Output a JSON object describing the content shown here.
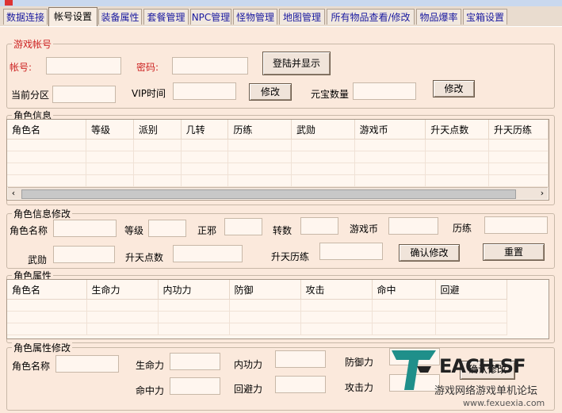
{
  "tabs": [
    "数据连接",
    "帐号设置",
    "装备属性",
    "套餐管理",
    "NPC管理",
    "怪物管理",
    "地图管理",
    "所有物品查看/修改",
    "物品爆率",
    "宝箱设置"
  ],
  "account": {
    "title": "游戏帐号",
    "account_label": "帐号:",
    "password_label": "密码:",
    "login_button": "登陆并显示",
    "zone_label": "当前分区",
    "vip_label": "VIP时间",
    "vip_modify": "修改",
    "yuanbao_label": "元宝数量",
    "yuanbao_modify": "修改"
  },
  "role_info": {
    "title": "角色信息",
    "columns": [
      "角色名",
      "等级",
      "派别",
      "几转",
      "历练",
      "武勋",
      "游戏币",
      "升天点数",
      "升天历练"
    ]
  },
  "role_edit": {
    "title": "角色信息修改",
    "name": "角色名称",
    "level": "等级",
    "alignment": "正邪",
    "rebirth": "转数",
    "coins": "游戏币",
    "experience": "历练",
    "honor": "武勋",
    "ascend_points": "升天点数",
    "ascend_exp": "升天历练",
    "confirm": "确认修改",
    "reset": "重置"
  },
  "role_attr": {
    "title": "角色属性",
    "columns": [
      "角色名",
      "生命力",
      "内功力",
      "防御",
      "攻击",
      "命中",
      "回避"
    ]
  },
  "attr_edit": {
    "title": "角色属性修改",
    "name": "角色名称",
    "hp": "生命力",
    "mp": "内功力",
    "defense": "防御力",
    "accuracy": "命中力",
    "evasion": "回避力",
    "attack": "攻击力",
    "confirm": "确认修改"
  },
  "watermark": {
    "brand": "EACH·SF",
    "subtitle": "游戏网络游戏单机论坛",
    "url": "www.fexuexia.com"
  }
}
